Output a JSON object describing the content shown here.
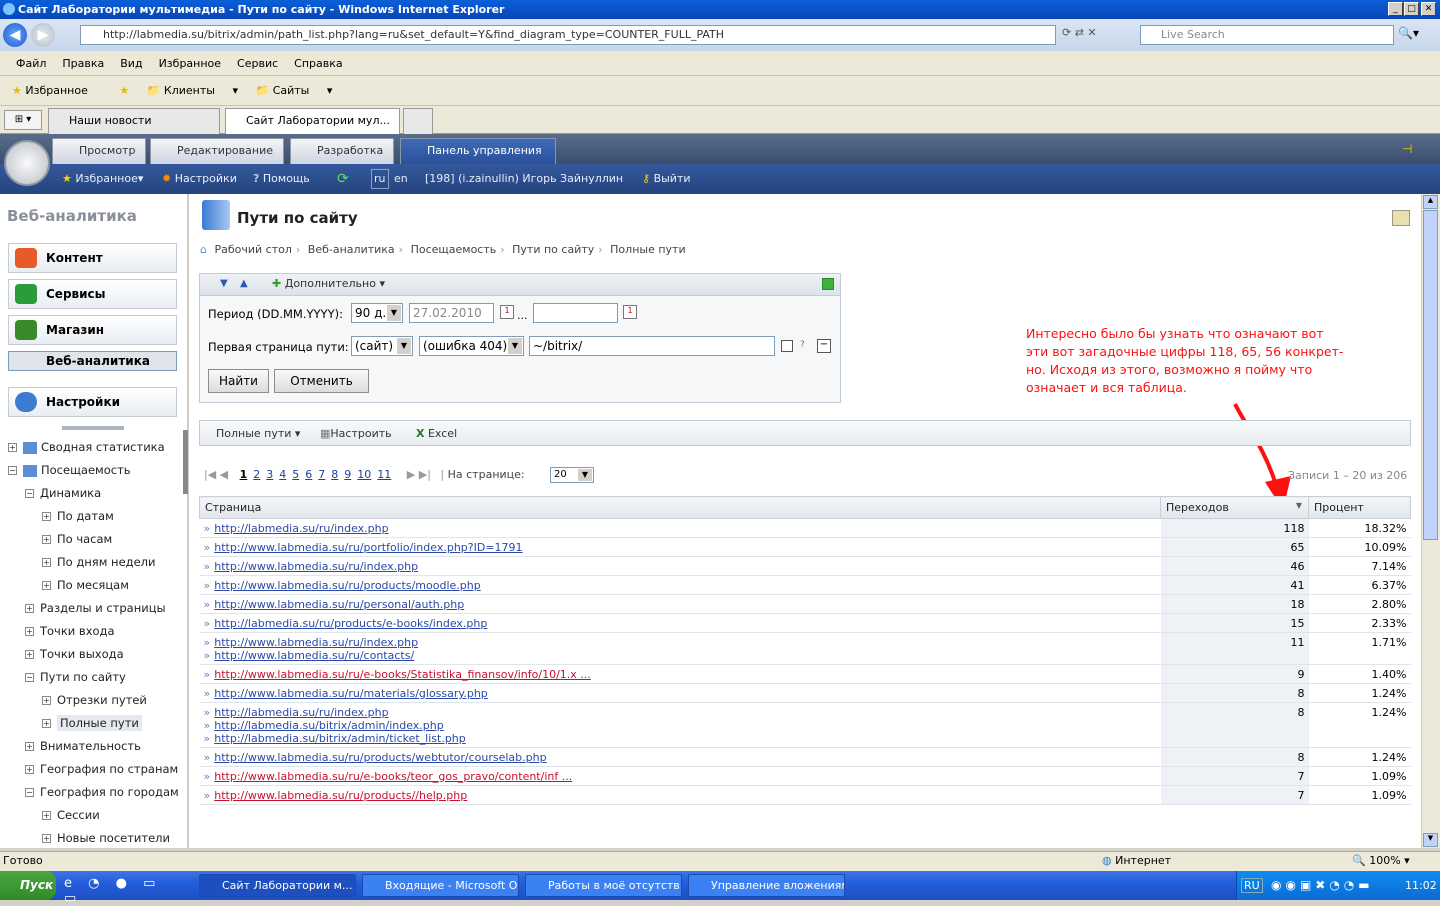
{
  "window": {
    "title": "Сайт Лаборатории мультимедиа - Пути по сайту - Windows Internet Explorer"
  },
  "address": {
    "url": "http://labmedia.su/bitrix/admin/path_list.php?lang=ru&set_default=Y&find_diagram_type=COUNTER_FULL_PATH",
    "search_placeholder": "Live Search"
  },
  "menu": [
    "Файл",
    "Правка",
    "Вид",
    "Избранное",
    "Сервис",
    "Справка"
  ],
  "favbar": {
    "favorites": "Избранное",
    "clients": "Клиенты",
    "sites": "Сайты"
  },
  "ie_tabs": [
    "Наши новости",
    "Сайт Лаборатории мул..."
  ],
  "bx_tabs": [
    "Просмотр",
    "Редактирование",
    "Разработка",
    "Панель управления"
  ],
  "bx_bar": {
    "favorites": "Избранное",
    "settings": "Настройки",
    "help": "Помощь",
    "lang_ru": "ru",
    "lang_en": "en",
    "user": "[198] (i.zainullin) Игорь Зайнуллин",
    "logout": "Выйти"
  },
  "left": {
    "title": "Веб-аналитика",
    "buttons": [
      "Контент",
      "Сервисы",
      "Магазин",
      "Веб-аналитика",
      "Настройки"
    ],
    "tree": [
      {
        "label": "Сводная статистика",
        "level": 0,
        "mark": "+"
      },
      {
        "label": "Посещаемость",
        "level": 0,
        "mark": "−"
      },
      {
        "label": "Динамика",
        "level": 1,
        "mark": "−"
      },
      {
        "label": "По датам",
        "level": 2,
        "mark": "+"
      },
      {
        "label": "По часам",
        "level": 2,
        "mark": "+"
      },
      {
        "label": "По дням недели",
        "level": 2,
        "mark": "+"
      },
      {
        "label": "По месяцам",
        "level": 2,
        "mark": "+"
      },
      {
        "label": "Разделы и страницы",
        "level": 1,
        "mark": "+"
      },
      {
        "label": "Точки входа",
        "level": 1,
        "mark": "+"
      },
      {
        "label": "Точки выхода",
        "level": 1,
        "mark": "+"
      },
      {
        "label": "Пути по сайту",
        "level": 1,
        "mark": "−"
      },
      {
        "label": "Отрезки путей",
        "level": 2,
        "mark": "+"
      },
      {
        "label": "Полные пути",
        "level": 2,
        "mark": "+"
      },
      {
        "label": "Внимательность",
        "level": 1,
        "mark": "+"
      },
      {
        "label": "География по странам",
        "level": 1,
        "mark": "+"
      },
      {
        "label": "География по городам",
        "level": 1,
        "mark": "−"
      },
      {
        "label": "Сессии",
        "level": 2,
        "mark": "+"
      },
      {
        "label": "Новые посетители",
        "level": 2,
        "mark": "+"
      }
    ]
  },
  "page": {
    "title": "Пути по сайту",
    "breadcrumbs": [
      "Рабочий стол",
      "Веб-аналитика",
      "Посещаемость",
      "Пути по сайту",
      "Полные пути"
    ]
  },
  "filter": {
    "more": "Дополнительно",
    "period_label": "Период (DD.MM.YYYY):",
    "period_select": "90 д.",
    "date_from": "27.02.2010",
    "date_to": "",
    "first_page_label": "Первая страница пути:",
    "site_select": "(сайт)",
    "error_select": "(ошибка 404)",
    "path_value": "~/bitrix/",
    "find": "Найти",
    "cancel": "Отменить"
  },
  "toolbar": {
    "full_paths": "Полные пути",
    "configure": "Настроить",
    "excel": "Excel"
  },
  "pager": {
    "pages": [
      "1",
      "2",
      "3",
      "4",
      "5",
      "6",
      "7",
      "8",
      "9",
      "10",
      "11"
    ],
    "per_page_label": "На странице:",
    "per_page": "20",
    "records": "Записи 1 – 20 из 206"
  },
  "table": {
    "headers": [
      "Страница",
      "Переходов",
      "Процент"
    ],
    "rows": [
      {
        "links": [
          "http://labmedia.su/ru/index.php"
        ],
        "count": "118",
        "pct": "18.32%"
      },
      {
        "links": [
          "http://www.labmedia.su/ru/portfolio/index.php?ID=1791"
        ],
        "count": "65",
        "pct": "10.09%"
      },
      {
        "links": [
          "http://www.labmedia.su/ru/index.php"
        ],
        "count": "46",
        "pct": "7.14%"
      },
      {
        "links": [
          "http://www.labmedia.su/ru/products/moodle.php"
        ],
        "count": "41",
        "pct": "6.37%"
      },
      {
        "links": [
          "http://www.labmedia.su/ru/personal/auth.php"
        ],
        "count": "18",
        "pct": "2.80%"
      },
      {
        "links": [
          "http://labmedia.su/ru/products/e-books/index.php"
        ],
        "count": "15",
        "pct": "2.33%"
      },
      {
        "links": [
          "http://www.labmedia.su/ru/index.php",
          "http://www.labmedia.su/ru/contacts/"
        ],
        "count": "11",
        "pct": "1.71%"
      },
      {
        "links": [
          "http://www.labmedia.su/ru/e-books/Statistika_finansov/info/10/1.x ..."
        ],
        "red": true,
        "count": "9",
        "pct": "1.40%"
      },
      {
        "links": [
          "http://www.labmedia.su/ru/materials/glossary.php"
        ],
        "count": "8",
        "pct": "1.24%"
      },
      {
        "links": [
          "http://labmedia.su/ru/index.php",
          "http://labmedia.su/bitrix/admin/index.php",
          "http://labmedia.su/bitrix/admin/ticket_list.php"
        ],
        "count": "8",
        "pct": "1.24%"
      },
      {
        "links": [
          "http://www.labmedia.su/ru/products/webtutor/courselab.php"
        ],
        "count": "8",
        "pct": "1.24%"
      },
      {
        "links": [
          "http://www.labmedia.su/ru/e-books/teor_gos_pravo/content/inf ..."
        ],
        "red": true,
        "count": "7",
        "pct": "1.09%"
      },
      {
        "links": [
          "http://www.labmedia.su/ru/products//help.php"
        ],
        "red": true,
        "count": "7",
        "pct": "1.09%"
      }
    ]
  },
  "note": "Интересно было бы узнать что означают вот эти вот загадочные цифры 118, 65, 56 конкрет-но. Исходя из этого, возможно я пойму что означает и вся таблица.",
  "status": {
    "text": "Готово",
    "zone": "Интернет",
    "zoom": "100%"
  },
  "taskbar": {
    "start": "Пуск",
    "tasks": [
      "Сайт Лаборатории м...",
      "Входящие - Microsoft O...",
      "Работы в моё отсутств...",
      "Управление вложениям..."
    ],
    "lang": "RU",
    "clock": "11:02"
  },
  "colors": {
    "accent": "#2a48a8",
    "note": "#ff1010",
    "panel": "#34589c"
  }
}
